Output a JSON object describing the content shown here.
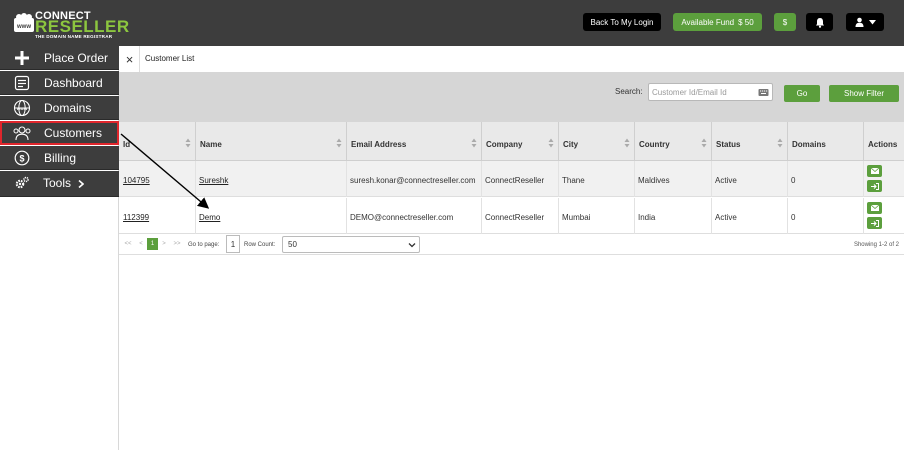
{
  "brand": {
    "top": "CONNECT",
    "main": "RESELLER",
    "tagline": "THE DOMAIN NAME REGISTRAR"
  },
  "header": {
    "back_login": "Back To My Login",
    "fund_label": "Available Fund",
    "fund_value": "$ 50",
    "dollar_label": "$",
    "bell_icon": "bell-icon",
    "user_icon": "user-icon"
  },
  "sidebar": {
    "items": [
      {
        "label": "Place Order",
        "icon": "plus-icon"
      },
      {
        "label": "Dashboard",
        "icon": "dashboard-icon"
      },
      {
        "label": "Domains",
        "icon": "globe-icon"
      },
      {
        "label": "Customers",
        "icon": "customers-icon",
        "active": true
      },
      {
        "label": "Billing",
        "icon": "dollar-circle-icon"
      },
      {
        "label": "Tools",
        "icon": "gears-icon"
      }
    ]
  },
  "tab": {
    "label": "Customer List",
    "close": "×"
  },
  "filter": {
    "search_label": "Search:",
    "search_placeholder": "Customer Id/Email Id",
    "go_label": "Go",
    "show_filter_label": "Show Filter"
  },
  "table": {
    "columns": [
      "Id",
      "Name",
      "Email Address",
      "Company",
      "City",
      "Country",
      "Status",
      "Domains",
      "Actions"
    ],
    "rows": [
      {
        "id": "104795",
        "name": "Sureshk",
        "email": "suresh.konar@connectreseller.com",
        "company": "ConnectReseller",
        "city": "Thane",
        "country": "Maldives",
        "status": "Active",
        "domains": "0"
      },
      {
        "id": "112399",
        "name": "Demo",
        "email": "DEMO@connectreseller.com",
        "company": "ConnectReseller",
        "city": "Mumbai",
        "country": "India",
        "status": "Active",
        "domains": "0"
      }
    ]
  },
  "pager": {
    "first": "<<",
    "prev": "<",
    "current": "1",
    "next": ">",
    "last": ">>",
    "goto_label": "Go to page:",
    "goto_value": "1",
    "rowcount_label": "Row Count:",
    "rowcount_value": "50",
    "showing": "Showing 1-2 of 2"
  },
  "colors": {
    "topbar": "#3d3d3d",
    "accent_green": "#5c9f3d",
    "brand_green": "#8cc63f",
    "highlight_red": "#e0262c"
  }
}
